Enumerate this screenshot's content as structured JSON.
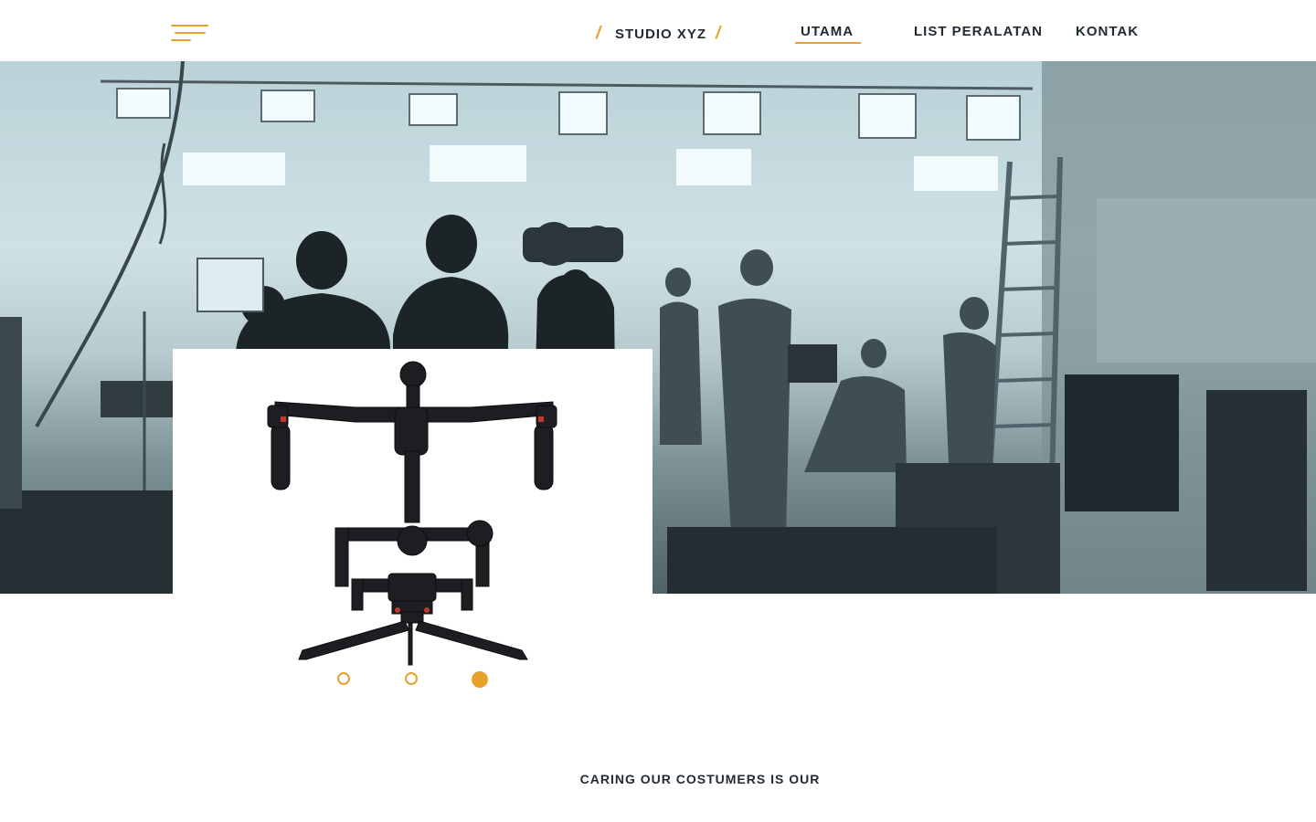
{
  "header": {
    "menu_icon": "hamburger-menu-icon",
    "brand": {
      "slash_left": "/",
      "name": "STUDIO XYZ",
      "slash_right": "/"
    },
    "nav": [
      {
        "label": "UTAMA",
        "active": true
      },
      {
        "label": "LIST PERALATAN",
        "active": false
      },
      {
        "label": "KONTAK",
        "active": false
      }
    ]
  },
  "hero": {
    "image": "film-studio-crew-photo"
  },
  "product": {
    "image": "camera-gimbal-stabilizer",
    "carousel": {
      "count": 3,
      "active_index": 2
    }
  },
  "tagline": "CARING OUR COSTUMERS IS OUR",
  "colors": {
    "accent": "#e8a12d",
    "text": "#1f2a33"
  }
}
